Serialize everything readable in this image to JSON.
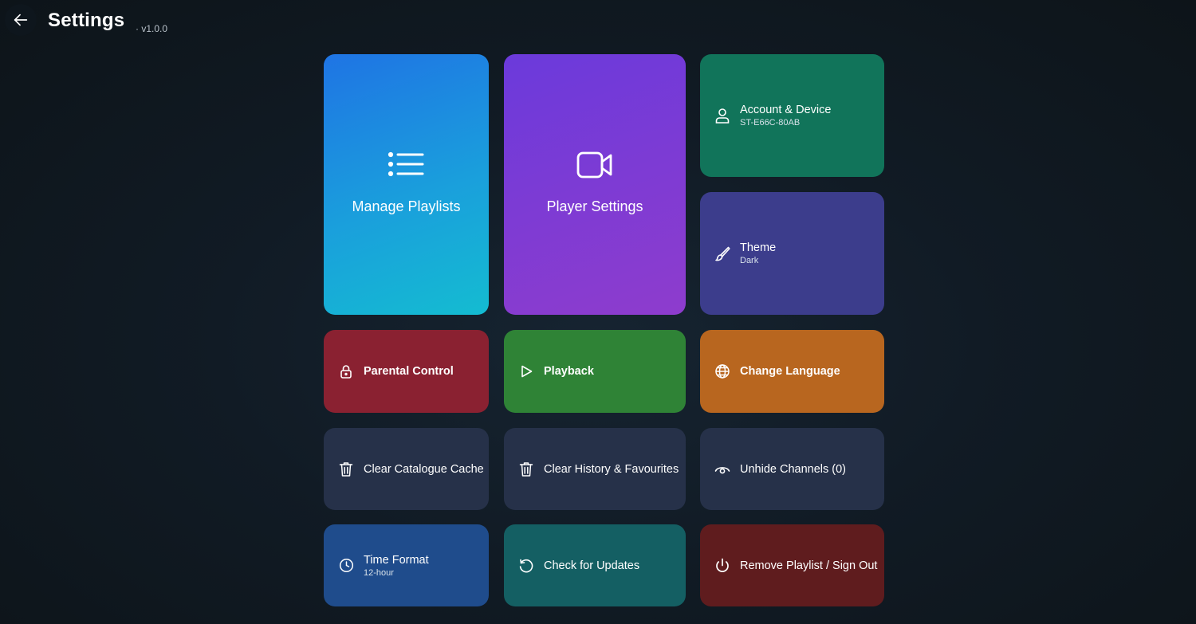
{
  "header": {
    "title": "Settings",
    "version": "· v1.0.0"
  },
  "tiles": {
    "manage_playlists": {
      "label": "Manage Playlists",
      "icon": "list-icon"
    },
    "player_settings": {
      "label": "Player Settings",
      "icon": "video-camera-icon"
    },
    "account_device": {
      "label": "Account & Device",
      "sublabel": "ST-E66C-80AB",
      "icon": "user-icon"
    },
    "theme": {
      "label": "Theme",
      "sublabel": "Dark",
      "icon": "brush-icon"
    },
    "parental_control": {
      "label": "Parental Control",
      "icon": "lock-icon"
    },
    "playback": {
      "label": "Playback",
      "icon": "play-icon"
    },
    "change_language": {
      "label": "Change Language",
      "icon": "globe-icon"
    },
    "clear_catalogue_cache": {
      "label": "Clear Catalogue Cache",
      "icon": "trash-icon"
    },
    "clear_history_favourites": {
      "label": "Clear History & Favourites",
      "icon": "trash-icon"
    },
    "unhide_channels": {
      "label": "Unhide Channels (0)",
      "icon": "eye-icon"
    },
    "time_format": {
      "label": "Time Format",
      "sublabel": "12-hour",
      "icon": "clock-icon"
    },
    "check_updates": {
      "label": "Check for Updates",
      "icon": "refresh-icon"
    },
    "remove_playlist": {
      "label": "Remove Playlist / Sign Out",
      "icon": "power-icon"
    }
  },
  "colors": {
    "manage_playlists": [
      "#1f78e3",
      "#15b8d2"
    ],
    "player_settings": [
      "#6f3bd8",
      "#8c3bcf"
    ],
    "account_device": "#11745a",
    "theme": "#3c3d8c",
    "parental_control": "#8a2131",
    "playback": "#2f8336",
    "change_language": "#b8661f",
    "neutral": "#263149",
    "time_format": "#1f4c8c",
    "check_updates": "#145f63",
    "remove_playlist": "#5f1c1e"
  }
}
